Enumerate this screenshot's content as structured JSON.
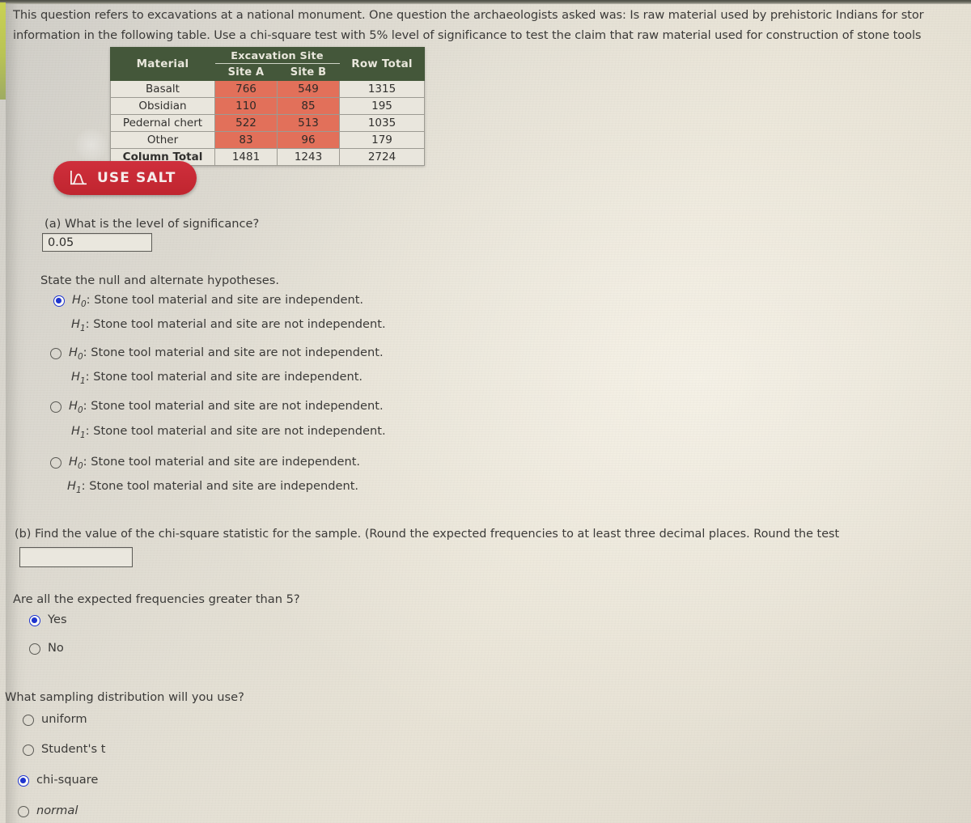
{
  "intro": {
    "line1": "This question refers to excavations at a national monument. One question the archaeologists asked was: Is raw material used by prehistoric Indians for stor",
    "line2": "information in the following table. Use a chi-square test with 5% level of significance to test the claim that raw material used for construction of stone tools"
  },
  "table": {
    "span_header": "Excavation Site",
    "headers": [
      "Material",
      "Site A",
      "Site B",
      "Row Total"
    ],
    "rows": [
      {
        "material": "Basalt",
        "site_a": "766",
        "site_b": "549",
        "row_total": "1315"
      },
      {
        "material": "Obsidian",
        "site_a": "110",
        "site_b": "85",
        "row_total": "195"
      },
      {
        "material": "Pedernal chert",
        "site_a": "522",
        "site_b": "513",
        "row_total": "1035"
      },
      {
        "material": "Other",
        "site_a": "83",
        "site_b": "96",
        "row_total": "179"
      }
    ],
    "total_row": {
      "material": "Column Total",
      "site_a": "1481",
      "site_b": "1243",
      "row_total": "2724"
    },
    "header_color": "#44573a",
    "highlight_color": "#e2705a"
  },
  "salt_button": {
    "label": "USE SALT",
    "icon": "normal-curve-icon",
    "color": "#c62a36"
  },
  "part_a": {
    "question": "(a) What is the level of significance?",
    "value": "0.05"
  },
  "hypotheses": {
    "prompt": "State the null and alternate hypotheses.",
    "options": [
      {
        "selected": true,
        "null_prefix": "H",
        "null_sub": "0",
        "null_text": ": Stone tool material and site are independent.",
        "alt_prefix": "H",
        "alt_sub": "1",
        "alt_text": ": Stone tool material and site are not independent."
      },
      {
        "selected": false,
        "null_prefix": "H",
        "null_sub": "0",
        "null_text": ": Stone tool material and site are not independent.",
        "alt_prefix": "H",
        "alt_sub": "1",
        "alt_text": ": Stone tool material and site are independent."
      },
      {
        "selected": false,
        "null_prefix": "H",
        "null_sub": "0",
        "null_text": ": Stone tool material and site are not independent.",
        "alt_prefix": "H",
        "alt_sub": "1",
        "alt_text": ": Stone tool material and site are not independent."
      },
      {
        "selected": false,
        "null_prefix": "H",
        "null_sub": "0",
        "null_text": ": Stone tool material and site are independent.",
        "alt_prefix": "H",
        "alt_sub": "1",
        "alt_text": ": Stone tool material and site are independent."
      }
    ]
  },
  "part_b": {
    "question": "(b) Find the value of the chi-square statistic for the sample. (Round the expected frequencies to at least three decimal places. Round the test",
    "value": ""
  },
  "expected_freq": {
    "question": "Are all the expected frequencies greater than 5?",
    "options": [
      {
        "label": "Yes",
        "selected": true
      },
      {
        "label": "No",
        "selected": false
      }
    ]
  },
  "sampling_distribution": {
    "question": "What sampling distribution will you use?",
    "options": [
      {
        "label": "uniform",
        "selected": false
      },
      {
        "label": "Student's t",
        "selected": false
      },
      {
        "label": "chi-square",
        "selected": true
      },
      {
        "label": "normal",
        "selected": false
      }
    ]
  }
}
